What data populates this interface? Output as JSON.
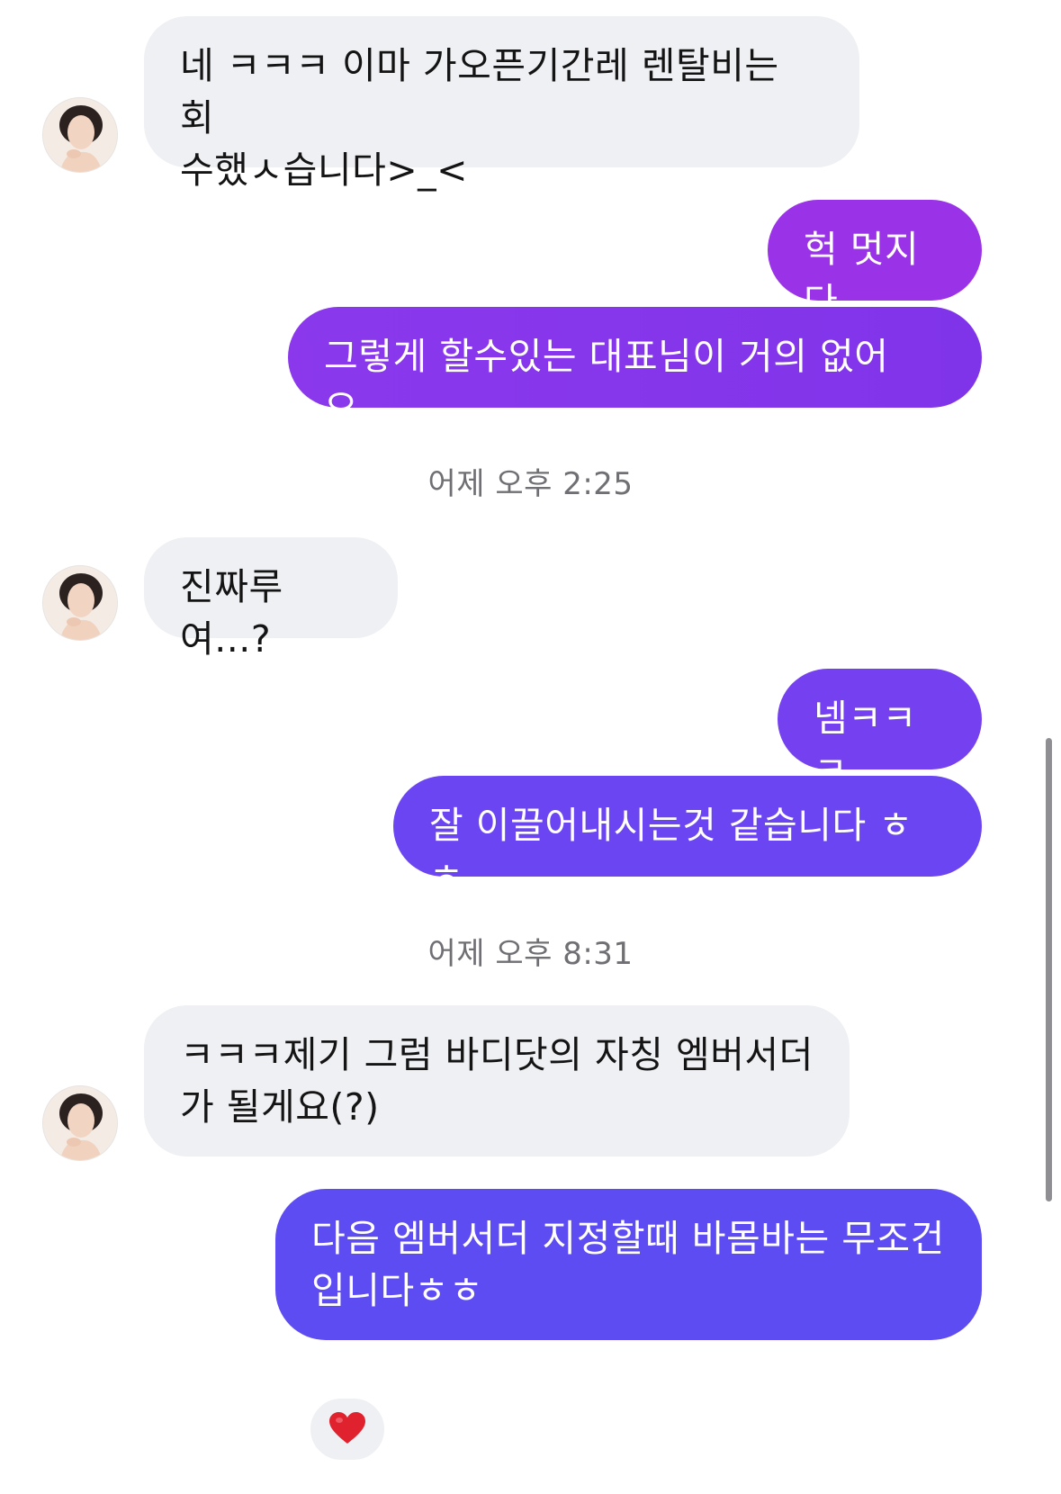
{
  "messages": [
    {
      "sender": "them",
      "text": "네 ㅋㅋㅋ 이마 가오픈기간레 렌탈비는 회\n수했ㅅ습니다>_<"
    },
    {
      "sender": "me",
      "text": "헉 멋지다"
    },
    {
      "sender": "me",
      "text": "그렇게 할수있는 대표님이 거의 없어요.."
    },
    {
      "sender": "them",
      "text": "진짜루여...?"
    },
    {
      "sender": "me",
      "text": "넴ㅋㅋㅋ"
    },
    {
      "sender": "me",
      "text": "잘 이끌어내시는것 같습니다 ㅎㅎ"
    },
    {
      "sender": "them",
      "text": "ㅋㅋㅋ제기 그럼 바디닷의 자칭 엠버서더\n가 될게요(?)"
    },
    {
      "sender": "me",
      "text": "다음 엠버서더 지정할때 바몸바는 무조건\n입니다ㅎㅎ"
    }
  ],
  "timestamps": [
    "어제 오후 2:25",
    "어제 오후 8:31"
  ],
  "reaction": {
    "icon": "heart-icon",
    "color": "#e0222f"
  },
  "colors": {
    "incoming_bubble": "#eff0f3",
    "outgoing_gradient": [
      "#9a32e8",
      "#6a47f4",
      "#5d4cf2"
    ],
    "timestamp_text": "#6f6f74"
  }
}
